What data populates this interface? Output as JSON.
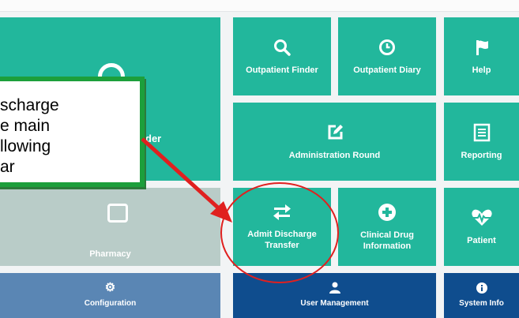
{
  "tiles": {
    "patient_finder": {
      "label": "Patient Finder",
      "icon": "user-circle-icon"
    },
    "outpatient_finder": {
      "label": "Outpatient Finder",
      "icon": "search-icon"
    },
    "outpatient_diary": {
      "label": "Outpatient Diary",
      "icon": "clock-icon"
    },
    "help": {
      "label": "Help",
      "icon": "flag-icon"
    },
    "administration_round": {
      "label": "Administration Round",
      "icon": "edit-icon"
    },
    "reporting": {
      "label": "Reporting",
      "icon": "report-icon"
    },
    "pharmacy": {
      "label": "Pharmacy",
      "icon": "pharmacy-icon"
    },
    "admit_discharge_transfer": {
      "label_line1": "Admit Discharge",
      "label_line2": "Transfer",
      "icon": "transfer-arrows-icon"
    },
    "clinical_drug_information": {
      "label_line1": "Clinical Drug",
      "label_line2": "Information",
      "icon": "plus-circle-icon"
    },
    "patient": {
      "label": "Patient",
      "icon": "heartbeat-icon"
    },
    "configuration": {
      "label": "Configuration",
      "icon": "gear-icon"
    },
    "user_management": {
      "label": "User Management",
      "icon": "user-icon"
    },
    "system_info": {
      "label": "System Info",
      "icon": "info-icon"
    }
  },
  "callout": {
    "lines": [
      "scharge",
      "e main",
      "llowing",
      "ar"
    ]
  },
  "partial_tile_text": "der",
  "colors": {
    "teal": "#22b79c",
    "grey": "#b9ccc8",
    "steel": "#5a86b4",
    "navy": "#0f4d8e",
    "callout_border": "#1c9f3b",
    "annotation_red": "#e0201f"
  }
}
